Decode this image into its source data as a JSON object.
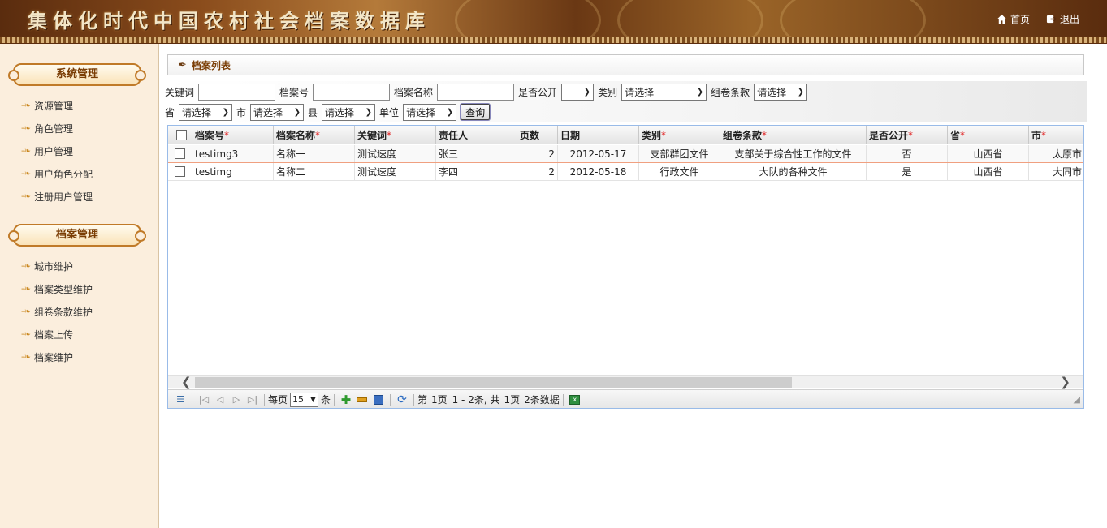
{
  "header": {
    "site_title": "集体化时代中国农村社会档案数据库",
    "nav": [
      {
        "label": "首页",
        "icon": "home-icon"
      },
      {
        "label": "退出",
        "icon": "logout-icon"
      }
    ]
  },
  "sidebar": {
    "sections": [
      {
        "title": "系统管理",
        "items": [
          "资源管理",
          "角色管理",
          "用户管理",
          "用户角色分配",
          "注册用户管理"
        ]
      },
      {
        "title": "档案管理",
        "items": [
          "城市维护",
          "档案类型维护",
          "组卷条款维护",
          "档案上传",
          "档案维护"
        ]
      }
    ]
  },
  "panel": {
    "title": "档案列表"
  },
  "search": {
    "keyword_label": "关键词",
    "archive_no_label": "档案号",
    "archive_name_label": "档案名称",
    "public_label": "是否公开",
    "category_label": "类别",
    "category_value": "请选择",
    "clause_label": "组卷条款",
    "clause_value": "请选择",
    "province_label": "省",
    "province_value": "请选择",
    "city_label": "市",
    "city_value": "请选择",
    "county_label": "县",
    "county_value": "请选择",
    "unit_label": "单位",
    "unit_value": "请选择",
    "query_button": "查询"
  },
  "grid": {
    "columns": [
      {
        "label": "档案号",
        "required": true
      },
      {
        "label": "档案名称",
        "required": true
      },
      {
        "label": "关键词",
        "required": true
      },
      {
        "label": "责任人",
        "required": false
      },
      {
        "label": "页数",
        "required": false
      },
      {
        "label": "日期",
        "required": false
      },
      {
        "label": "类别",
        "required": true
      },
      {
        "label": "组卷条款",
        "required": true
      },
      {
        "label": "是否公开",
        "required": true
      },
      {
        "label": "省",
        "required": true
      },
      {
        "label": "市",
        "required": true
      }
    ],
    "rows": [
      [
        "testimg3",
        "名称一",
        "测试速度",
        "张三",
        "2",
        "2012-05-17",
        "支部群团文件",
        "支部关于综合性工作的文件",
        "否",
        "山西省",
        "太原市"
      ],
      [
        "testimg",
        "名称二",
        "测试速度",
        "李四",
        "2",
        "2012-05-18",
        "行政文件",
        "大队的各种文件",
        "是",
        "山西省",
        "大同市"
      ]
    ]
  },
  "pager": {
    "per_page_label": "每页",
    "per_page_value": "15",
    "unit_label": "条",
    "page_prefix": "第",
    "current_page": "1页",
    "range": "1 - 2条, 共",
    "total_pages": "1页",
    "total_records": "2条数据"
  },
  "colors": {
    "accent": "#7a3d05",
    "required_mark": "#e02020",
    "grid_border": "#99bbe8"
  }
}
